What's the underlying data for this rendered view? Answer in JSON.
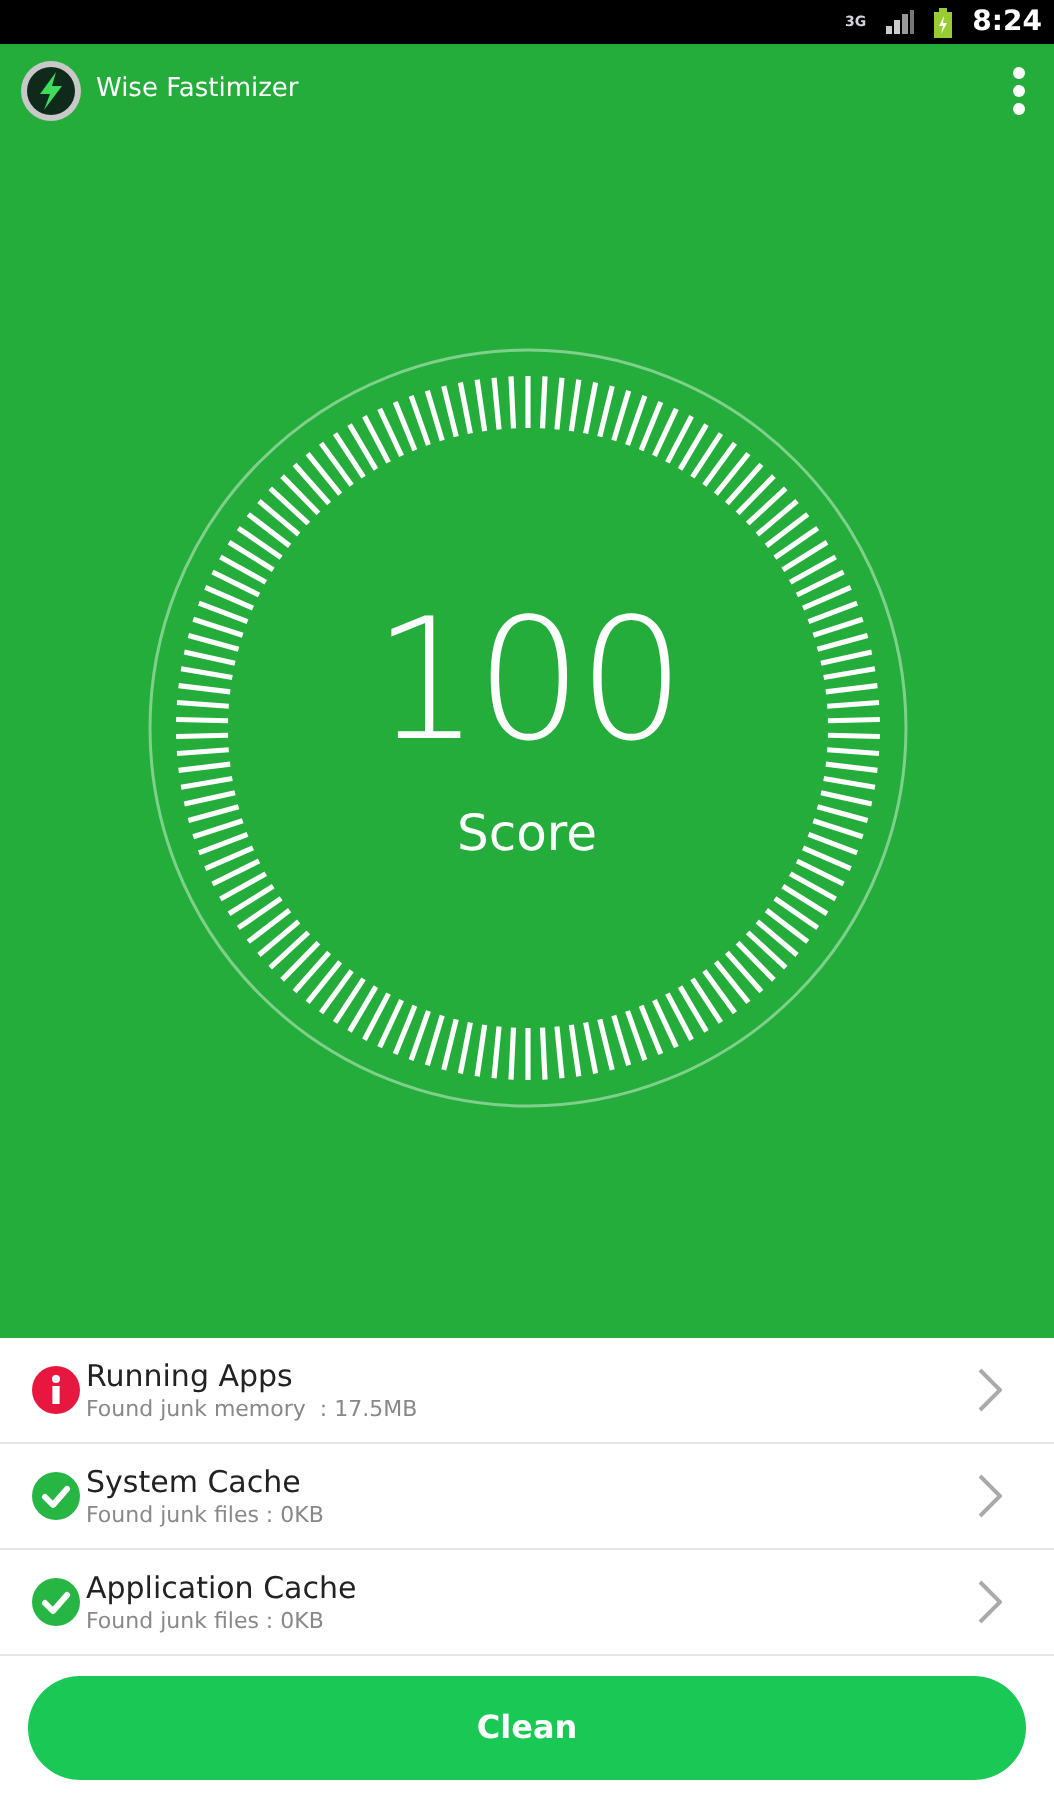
{
  "status_bar": {
    "network": "3G",
    "time": "8:24"
  },
  "app_bar": {
    "title": "Wise Fastimizer"
  },
  "dial": {
    "score": "100",
    "label": "Score"
  },
  "items": [
    {
      "title": "Running Apps",
      "detail": "Found junk memory  : 17.5MB",
      "kind": "warning"
    },
    {
      "title": "System Cache",
      "detail": "Found junk files : 0KB",
      "kind": "ok"
    },
    {
      "title": "Application Cache",
      "detail": "Found junk files : 0KB",
      "kind": "ok"
    }
  ],
  "button": "Clean"
}
